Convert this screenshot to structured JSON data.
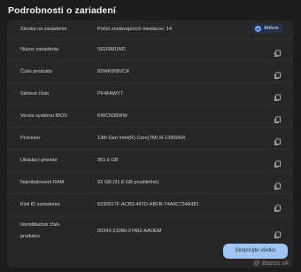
{
  "page": {
    "title": "Podrobnosti o zariadení"
  },
  "rows": [
    {
      "label": "Záruka na zariadenie",
      "value": "Počet zostávajúcich mesiacov: 14",
      "badge": "Aktívne"
    },
    {
      "label": "Názov zariadenia",
      "value": "SIGISMUND"
    },
    {
      "label": "Číslo produktu",
      "value": "82WK008VCK"
    },
    {
      "label": "Sériové číslo",
      "value": "PF4FAWY7"
    },
    {
      "label": "Verzia systému BIOS",
      "value": "KWCN36WW"
    },
    {
      "label": "Procesor",
      "value": "13th Gen Intel(R) Core(TM) i9-13900HX"
    },
    {
      "label": "Ukladací priestor",
      "value": "951.6 GB"
    },
    {
      "label": "Nainštalované RAM",
      "value": "32 GB (31.8 GB použiteľné)"
    },
    {
      "label": "Kód ID zariadenia",
      "value": "6230517F-ACB3-497D-ABFB-74A0C734A381"
    },
    {
      "label_line1": "Identifikačné číslo",
      "label_line2": "produktu",
      "value": "00342-21080-27482-AAOEM"
    }
  ],
  "actions": {
    "copy_all_label": "Skopírujte všetko"
  },
  "watermark": "@ Bazos.sk",
  "icons": {
    "copy": "copy-icon",
    "badge": "check-circle-icon"
  },
  "colors": {
    "accent": "#9ec6f0",
    "badge_check": "#6aa6ff",
    "background": "#1c1c1c",
    "panel": "#272727"
  }
}
